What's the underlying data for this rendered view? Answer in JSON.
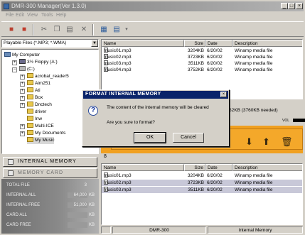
{
  "window": {
    "title": "DMR-300 Manager(Ver 1.3.0)"
  },
  "menu": [
    "File",
    "Edit",
    "View",
    "Tools",
    "Help"
  ],
  "filter": {
    "value": "Playable Files (*.MP3; *.WMA)"
  },
  "tree": [
    {
      "label": "My Computer",
      "icon": "computer-icon"
    },
    {
      "label": "3½ Floppy (A:)",
      "icon": "floppy-icon"
    },
    {
      "label": "(C:)",
      "icon": "drive-icon"
    },
    {
      "label": "acrobat_reader5",
      "icon": "folder-icon"
    },
    {
      "label": "Aim251",
      "icon": "folder-icon"
    },
    {
      "label": "Ati",
      "icon": "folder-icon"
    },
    {
      "label": "Box",
      "icon": "folder-icon"
    },
    {
      "label": "Dnctech",
      "icon": "folder-icon"
    },
    {
      "label": "driver",
      "icon": "folder-icon"
    },
    {
      "label": "Inw",
      "icon": "folder-icon"
    },
    {
      "label": "Multi-ICE",
      "icon": "folder-icon"
    },
    {
      "label": "My Documents",
      "icon": "folder-icon"
    },
    {
      "label": "My Music",
      "icon": "folder-icon"
    }
  ],
  "side_buttons": {
    "internal": "INTERNAL MEMORY",
    "card": "MEMORY CARD"
  },
  "stats": [
    {
      "label": "TOTAL FILE",
      "value": "3",
      "unit": ""
    },
    {
      "label": "INTERNAL ALL",
      "value": "64,000",
      "unit": "KB"
    },
    {
      "label": "INTERNAL FREE",
      "value": "51,000",
      "unit": "KB"
    },
    {
      "label": "CARD ALL",
      "value": "",
      "unit": "KB"
    },
    {
      "label": "CARD FREE",
      "value": "",
      "unit": "KB"
    }
  ],
  "columns": {
    "name": "Name",
    "size": "Size",
    "date": "Date",
    "desc": "Description"
  },
  "pc_files": [
    {
      "name": "music01.mp3",
      "size": "3204KB",
      "date": "6/20/02",
      "desc": "Winamp media file"
    },
    {
      "name": "music02.mp3",
      "size": "3723KB",
      "date": "6/20/02",
      "desc": "Winamp media file"
    },
    {
      "name": "music03.mp3",
      "size": "3511KB",
      "date": "6/20/02",
      "desc": "Winamp media file"
    },
    {
      "name": "music04.mp3",
      "size": "3752KB",
      "date": "6/20/02",
      "desc": "Winamp media file"
    }
  ],
  "needed": "52KB (3760KB needed)",
  "volume_label": "VOL",
  "device_files": [
    {
      "name": "music01.mp3",
      "size": "3204KB",
      "date": "6/20/02",
      "desc": "Winamp media file"
    },
    {
      "name": "music02.mp3",
      "size": "3723KB",
      "date": "6/20/02",
      "desc": "Winamp media file"
    },
    {
      "name": "music03.mp3",
      "size": "3511KB",
      "date": "6/20/02",
      "desc": "Winamp media file"
    }
  ],
  "status": {
    "device": "DMR-300",
    "location": "Internal Memory"
  },
  "dialog": {
    "title": "FORMAT INTERNAL MEMORY",
    "message": "The content of the internal memory will be cleared",
    "question": "Are you sure to format?",
    "ok": "OK",
    "cancel": "Cancel"
  }
}
